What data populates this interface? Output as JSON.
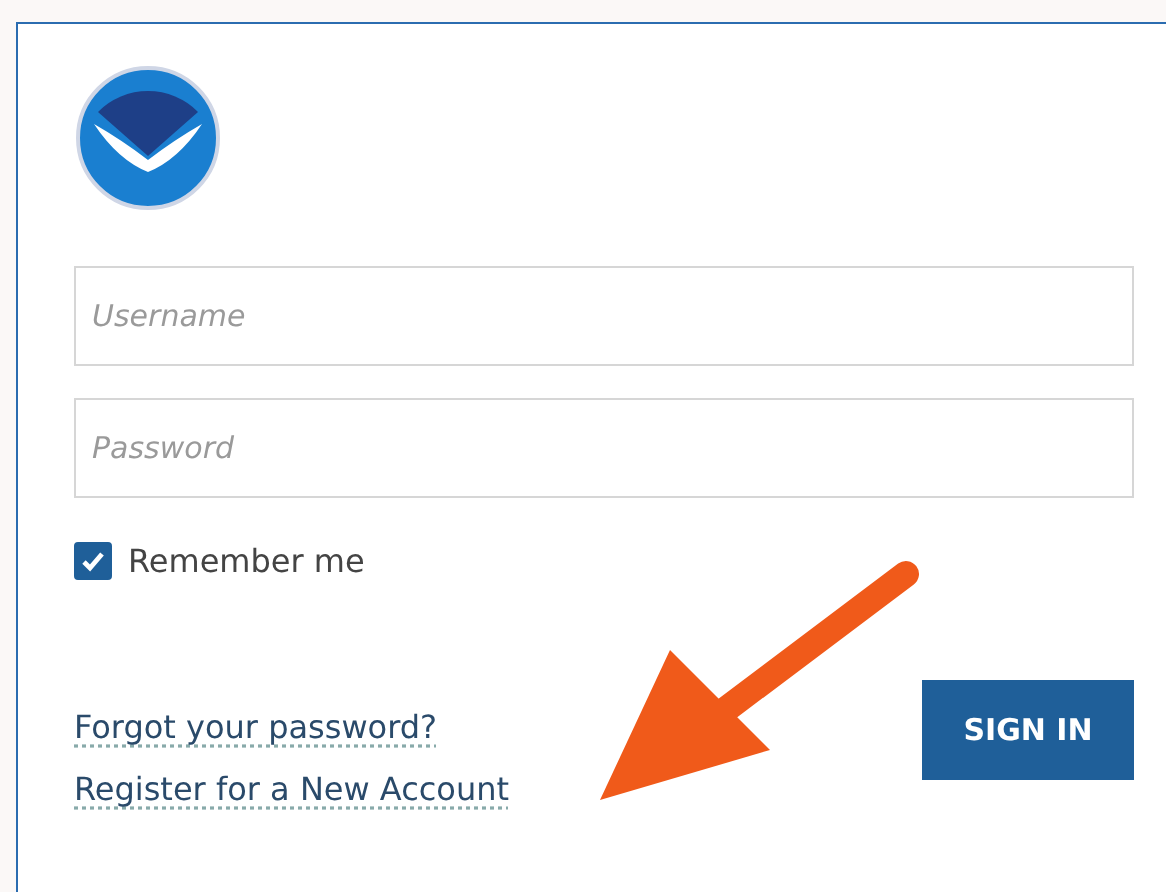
{
  "username": {
    "placeholder": "Username"
  },
  "password": {
    "placeholder": "Password"
  },
  "remember": {
    "label": "Remember me",
    "checked": true
  },
  "links": [
    {
      "label": "Forgot your password?"
    },
    {
      "label": "Register for a New Account"
    }
  ],
  "sign_in": {
    "label": "SIGN IN"
  }
}
